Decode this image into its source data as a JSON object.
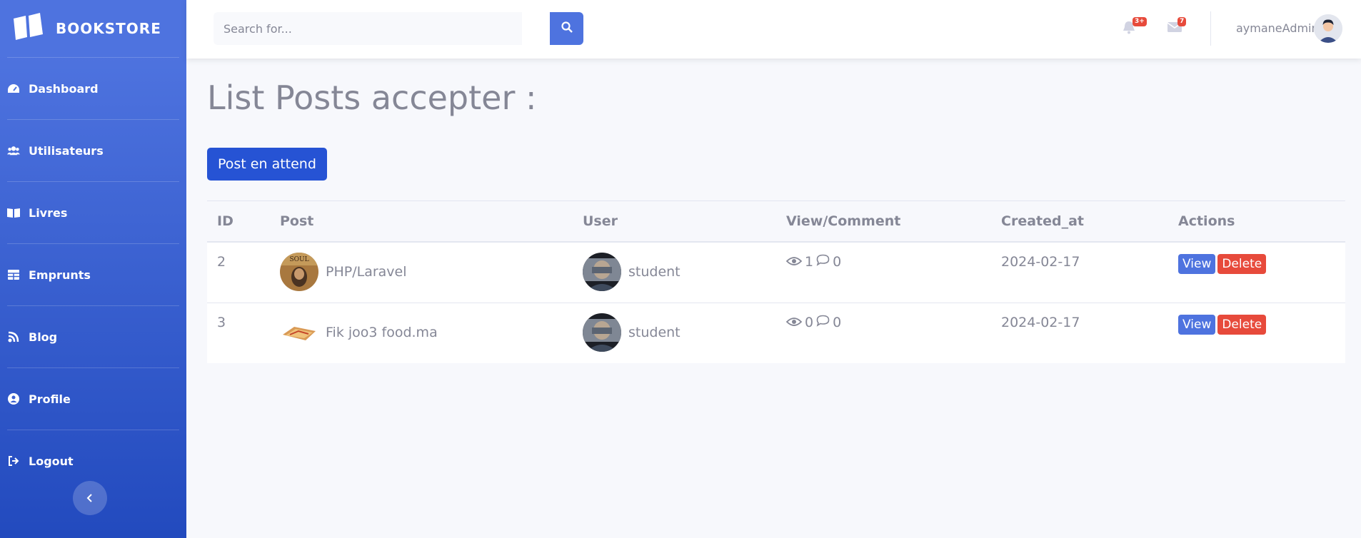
{
  "sidebar": {
    "brand": "BOOKSTORE",
    "items": [
      {
        "label": "Dashboard",
        "icon": "tachometer-icon"
      },
      {
        "label": "Utilisateurs",
        "icon": "users-icon"
      },
      {
        "label": "Livres",
        "icon": "book-open-icon"
      },
      {
        "label": "Emprunts",
        "icon": "table-icon"
      },
      {
        "label": "Blog",
        "icon": "blog-icon"
      },
      {
        "label": "Profile",
        "icon": "user-circle-icon"
      },
      {
        "label": "Logout",
        "icon": "sign-out-icon"
      }
    ]
  },
  "topbar": {
    "search_placeholder": "Search for...",
    "alerts_badge": "3+",
    "messages_badge": "7",
    "username": "aymaneAdmin"
  },
  "main": {
    "title": "List Posts accepter :",
    "pending_button": "Post en attend",
    "table": {
      "headers": [
        "ID",
        "Post",
        "User",
        "View/Comment",
        "Created_at",
        "Actions"
      ],
      "rows": [
        {
          "id": "2",
          "post": "PHP/Laravel",
          "user": "student",
          "views": "1",
          "comments": "0",
          "created_at": "2024-02-17",
          "view_label": "View",
          "delete_label": "Delete"
        },
        {
          "id": "3",
          "post": "Fik joo3 food.ma",
          "user": "student",
          "views": "0",
          "comments": "0",
          "created_at": "2024-02-17",
          "view_label": "View",
          "delete_label": "Delete"
        }
      ]
    }
  },
  "colors": {
    "sidebar_start": "#4e73df",
    "sidebar_end": "#224abe",
    "primary": "#2653d4",
    "danger": "#e74a3b"
  }
}
